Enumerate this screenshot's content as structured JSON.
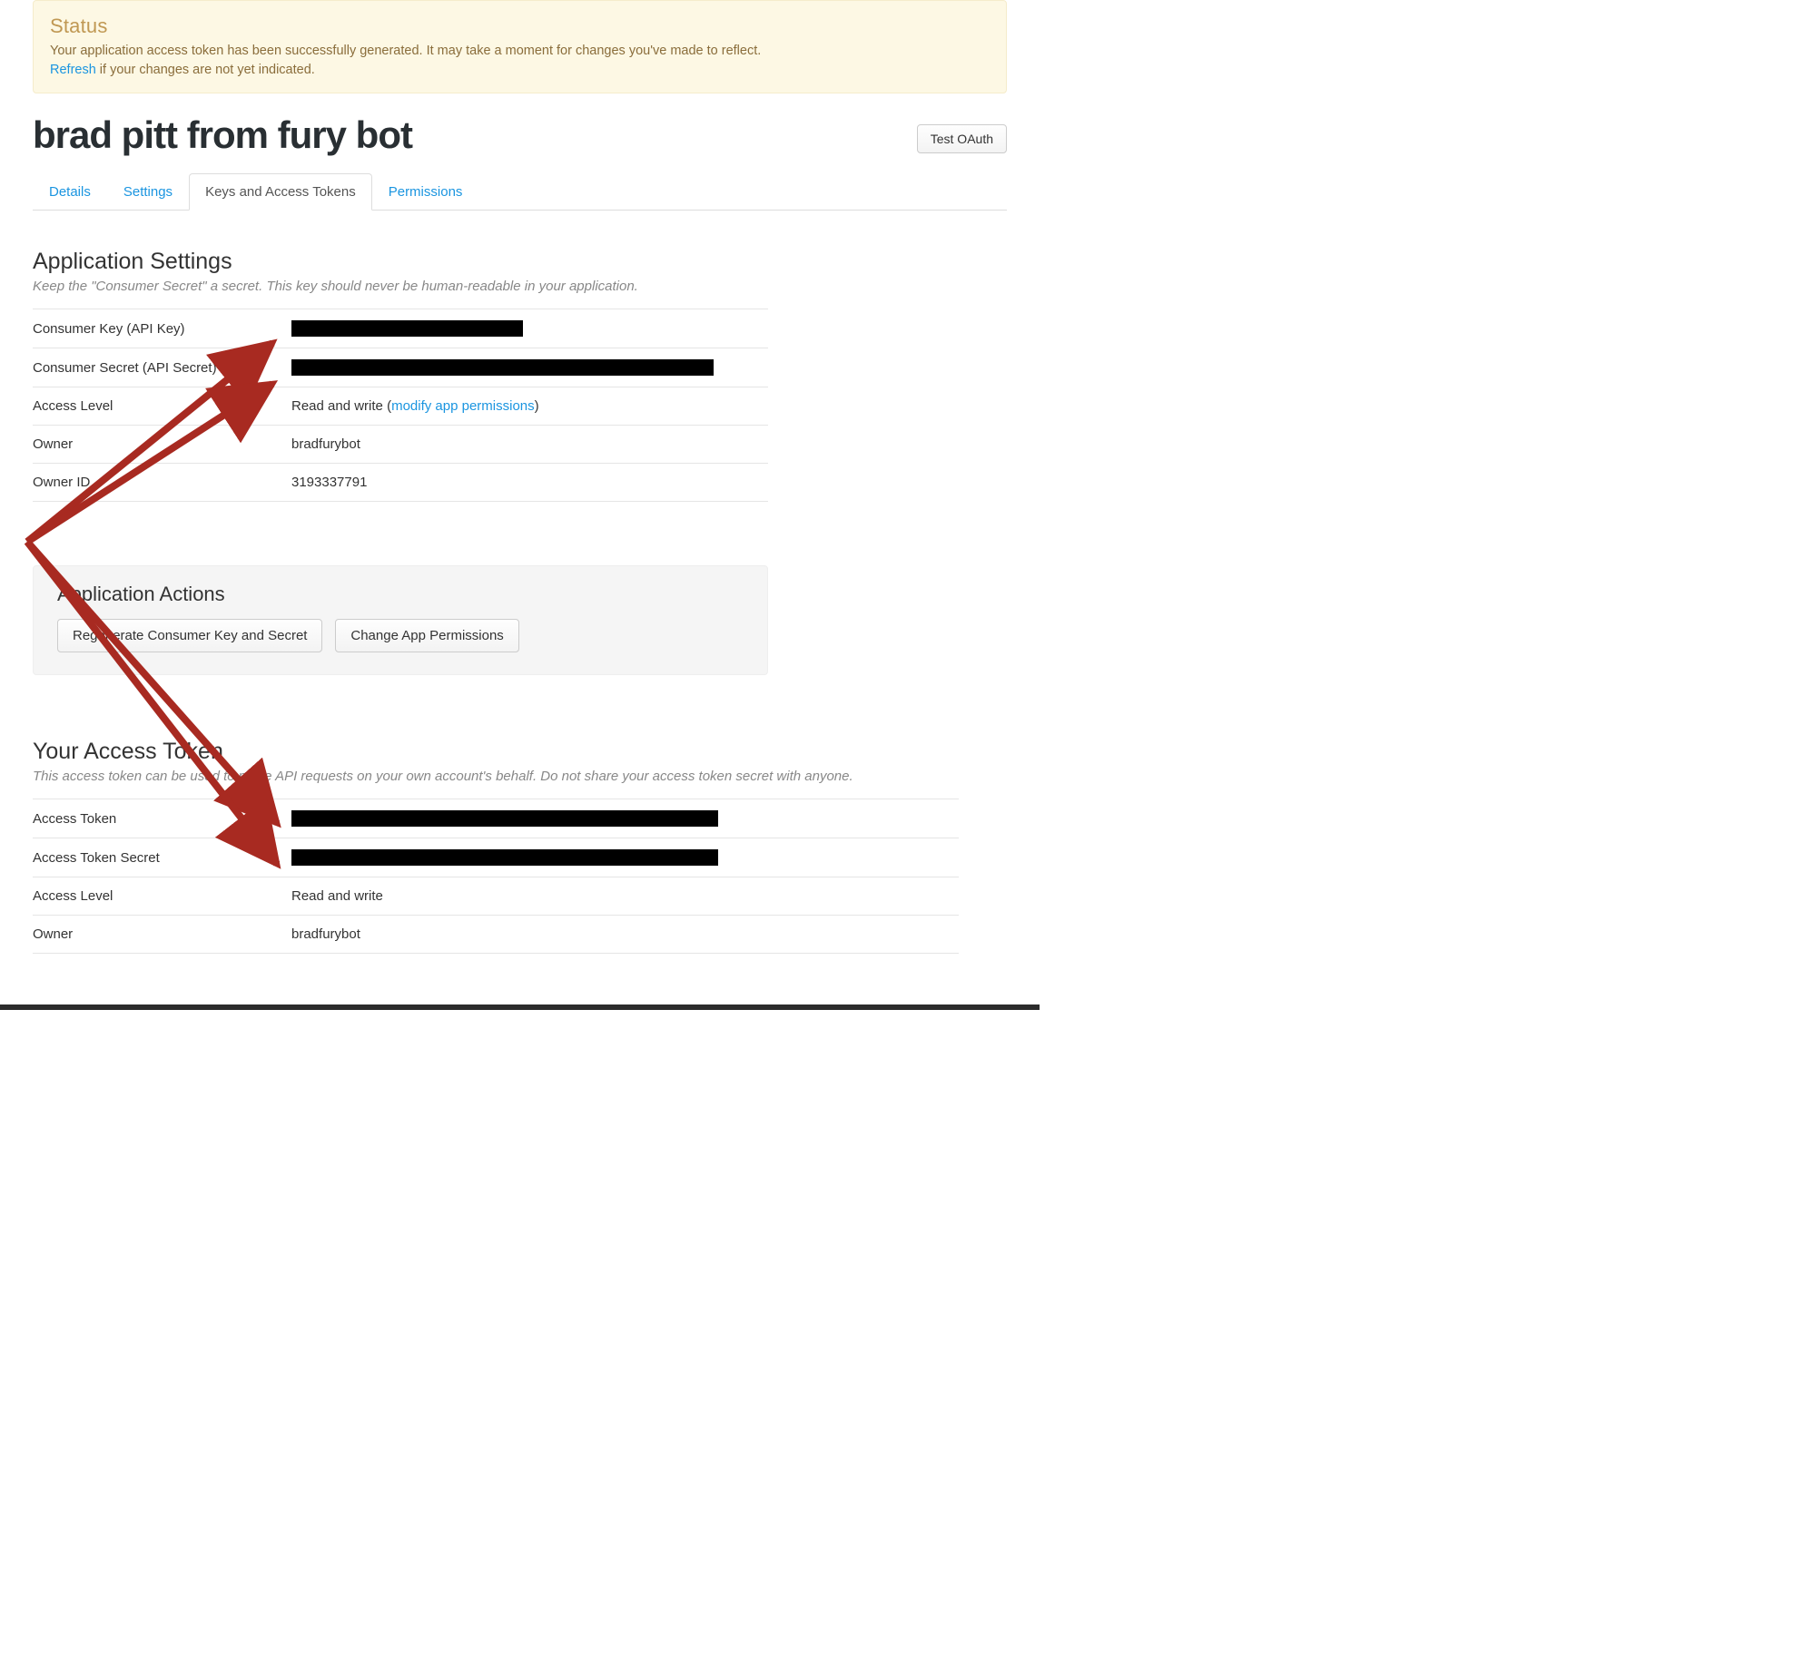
{
  "alert": {
    "title": "Status",
    "body": "Your application access token has been successfully generated. It may take a moment for changes you've made to reflect.",
    "refresh_label": "Refresh",
    "refresh_suffix": " if your changes are not yet indicated."
  },
  "header": {
    "app_name": "brad pitt from fury bot",
    "test_oauth_label": "Test OAuth"
  },
  "tabs": [
    {
      "label": "Details",
      "active": false
    },
    {
      "label": "Settings",
      "active": false
    },
    {
      "label": "Keys and Access Tokens",
      "active": true
    },
    {
      "label": "Permissions",
      "active": false
    }
  ],
  "app_settings": {
    "title": "Application Settings",
    "subtitle": "Keep the \"Consumer Secret\" a secret. This key should never be human-readable in your application.",
    "rows": {
      "consumer_key_label": "Consumer Key (API Key)",
      "consumer_secret_label": "Consumer Secret (API Secret)",
      "access_level_label": "Access Level",
      "access_level_value": "Read and write",
      "modify_perm_prefix": " (",
      "modify_perm_label": "modify app permissions",
      "modify_perm_suffix": ")",
      "owner_label": "Owner",
      "owner_value": "bradfurybot",
      "owner_id_label": "Owner ID",
      "owner_id_value": "3193337791"
    }
  },
  "actions_panel": {
    "title": "Application Actions",
    "regen_label": "Regenerate Consumer Key and Secret",
    "change_perm_label": "Change App Permissions"
  },
  "access_token": {
    "title": "Your Access Token",
    "subtitle": "This access token can be used to make API requests on your own account's behalf. Do not share your access token secret with anyone.",
    "rows": {
      "token_label": "Access Token",
      "secret_label": "Access Token Secret",
      "access_level_label": "Access Level",
      "access_level_value": "Read and write",
      "owner_label": "Owner",
      "owner_value": "bradfurybot"
    }
  },
  "annotation": {
    "arrow_color": "#a82a21"
  }
}
